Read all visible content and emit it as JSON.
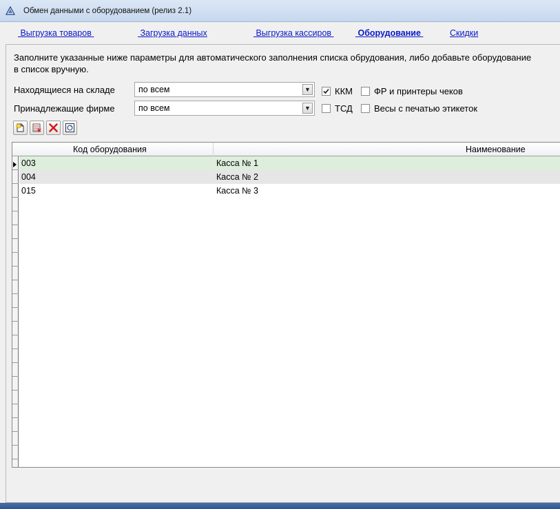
{
  "window": {
    "title": "Обмен данными с оборудованием (релиз 2.1)"
  },
  "tabs": [
    {
      "label": " Выгрузка товаров ",
      "active": false
    },
    {
      "label": " Загрузка данных",
      "active": false
    },
    {
      "label": " Выгрузка кассиров ",
      "active": false
    },
    {
      "label": " Оборудование ",
      "active": true
    },
    {
      "label": "Скидки",
      "active": false
    }
  ],
  "instructions": "Заполните указанные ниже параметры для автоматического заполнения списка обрудования, либо добавьте оборудование в список вручную.",
  "filters": {
    "warehouse": {
      "label": "Находящиеся на складе",
      "value": "по всем"
    },
    "company": {
      "label": "Принадлежащие фирме",
      "value": "по всем"
    }
  },
  "checkboxes": [
    {
      "label": "ККМ",
      "checked": true
    },
    {
      "label": "ФР и принтеры чеков",
      "checked": false
    },
    {
      "label": "ТСД",
      "checked": false
    },
    {
      "label": "Весы с печатью этикеток",
      "checked": false
    }
  ],
  "toolbar": {
    "icons": [
      "add-icon",
      "copy-icon",
      "delete-icon",
      "refresh-icon"
    ]
  },
  "table": {
    "columns": [
      "Код оборудования",
      "Наименование"
    ],
    "rows": [
      {
        "code": "003",
        "name": "Касса № 1"
      },
      {
        "code": "004",
        "name": "Касса № 2"
      },
      {
        "code": "015",
        "name": "Касса № 3"
      }
    ]
  },
  "colors": {
    "link": "#0a18c8",
    "selected_row": "#ddeedd",
    "alt_row": "#e6e6e6",
    "delete_icon": "#d81818"
  }
}
